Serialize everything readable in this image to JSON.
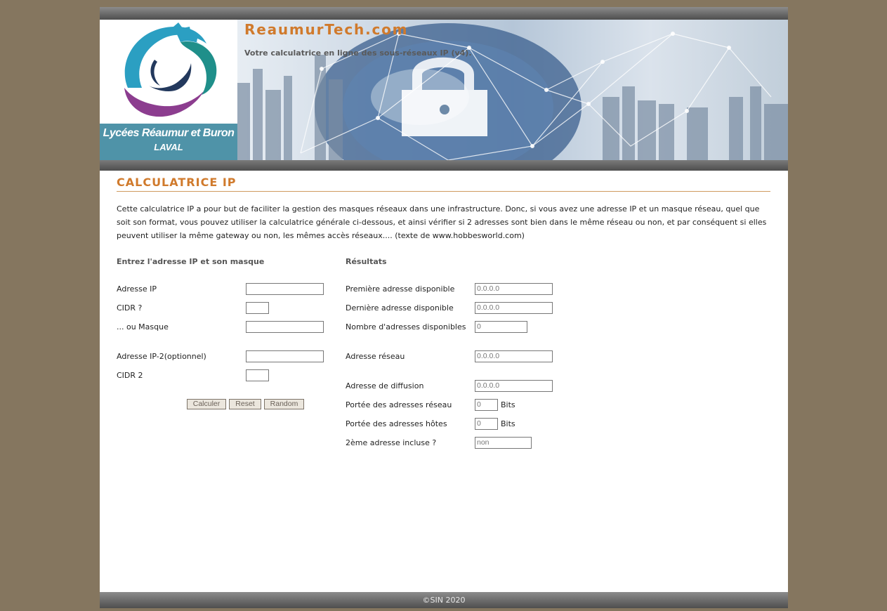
{
  "header": {
    "logo_line1": "Lycées Réaumur et Buron",
    "logo_line2": "LAVAL",
    "site_title": "ReaumurTech.com",
    "tagline": "Votre calculatrice en ligne des sous-réseaux IP (v4)."
  },
  "main": {
    "title": "CALCULATRICE IP",
    "intro": "Cette calculatrice IP a pour but de faciliter la gestion des masques réseaux dans une infrastructure. Donc, si vous avez une adresse IP et un masque réseau, quel que soit son format, vous pouvez utiliser la calculatrice générale ci-dessous, et ainsi vérifier si 2 adresses sont bien dans le même réseau ou non, et par conséquent si elles peuvent utiliser la même gateway ou non, les mêmes accès réseaux.... (texte de www.hobbesworld.com)"
  },
  "input_form": {
    "heading": "Entrez l'adresse IP et son masque",
    "ip_label": "Adresse IP",
    "ip_value": "",
    "cidr_label": "CIDR ?",
    "cidr_value": "",
    "mask_label": "... ou Masque",
    "mask_value": "",
    "ip2_label": "Adresse IP-2(optionnel)",
    "ip2_value": "",
    "cidr2_label": "CIDR 2",
    "cidr2_value": "",
    "btn_calc": "Calculer",
    "btn_reset": "Reset",
    "btn_random": "Random"
  },
  "results": {
    "heading": "Résultats",
    "first_label": "Première adresse disponible",
    "first_value": "0.0.0.0",
    "last_label": "Dernière adresse disponible",
    "last_value": "0.0.0.0",
    "count_label": "Nombre d'adresses disponibles",
    "count_value": "0",
    "network_label": "Adresse réseau",
    "network_value": "0.0.0.0",
    "broadcast_label": "Adresse de diffusion",
    "broadcast_value": "0.0.0.0",
    "net_range_label": "Portée des adresses réseau",
    "net_range_value": "0",
    "host_range_label": "Portée des adresses hôtes",
    "host_range_value": "0",
    "bits_unit": "Bits",
    "included_label": "2ème adresse incluse ?",
    "included_value": "non"
  },
  "footer": {
    "copyright": "©SIN 2020"
  },
  "colors": {
    "background": "#85765f",
    "accent": "#d07a2c",
    "logo_plate": "#4f93a8"
  }
}
